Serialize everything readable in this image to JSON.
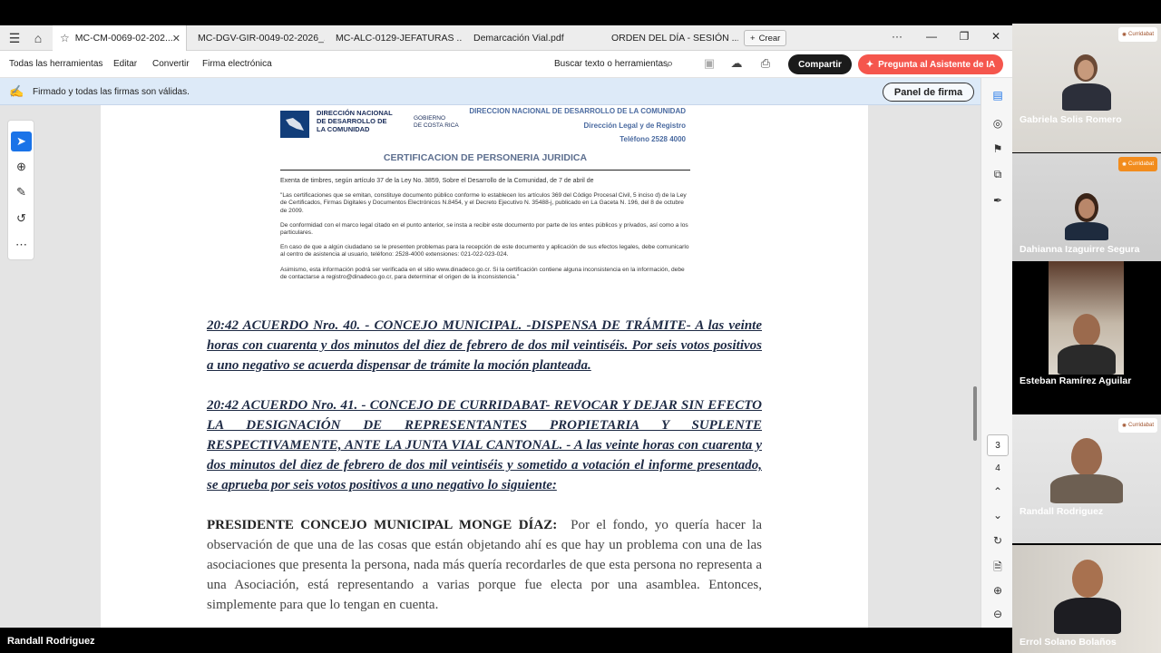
{
  "browser": {
    "tabs": [
      {
        "label": "MC-CM-0069-02-202..."
      },
      {
        "label": "MC-DGV-GIR-0049-02-2026_..."
      },
      {
        "label": "MC-ALC-0129-JEFATURAS ..."
      },
      {
        "label": "Demarcación Vial.pdf"
      },
      {
        "label": "ORDEN DEL DÍA - SESIÓN ..."
      }
    ],
    "new_tab_label": "Crear",
    "more_label": "···"
  },
  "menubar": {
    "items": [
      "Todas las herramientas",
      "Editar",
      "Convertir",
      "Firma electrónica"
    ],
    "search_label": "Buscar texto o herramientas",
    "share_label": "Compartir",
    "ai_label": "Pregunta al Asistente de IA"
  },
  "signature_bar": {
    "status": "Firmado y todas las firmas son válidas.",
    "panel_button": "Panel de firma"
  },
  "certificate": {
    "org_line1": "DIRECCIÓN NACIONAL",
    "org_line2": "DE DESARROLLO DE",
    "org_line3": "LA COMUNIDAD",
    "gov_line1": "GOBIERNO",
    "gov_line2": "DE COSTA RICA",
    "header_right1": "DIRECCION NACIONAL DE DESARROLLO DE LA COMUNIDAD",
    "header_right2": "Dirección Legal y de Registro",
    "header_right3": "Teléfono 2528 4000",
    "title": "CERTIFICACION DE PERSONERIA JURIDICA",
    "p1": "Exenta de timbres, según artículo 37 de la Ley No. 3859, Sobre el Desarrollo de la Comunidad, de 7 de abril de",
    "p2": "\"Las certificaciones que se emitan, constituye documento público conforme lo establecen los artículos 369 del Código Procesal Civil, 5 inciso d) de la Ley de Certificados, Firmas Digitales y Documentos Electrónicos N.8454, y el Decreto Ejecutivo N. 35488-j, publicado en La Gaceta N. 196, del 8 de octubre de 2009.",
    "p3": "De conformidad con el marco legal citado en el punto anterior, se insta a recibir este documento por parte de los entes públicos y privados, así como a los particulares.",
    "p4": "En caso de que a algún ciudadano se le presenten problemas para la recepción de este documento y aplicación de sus efectos legales, debe comunicarlo al centro de asistencia al usuario, teléfono: 2528-4000 extensiones: 021-022-023-024.",
    "p5": "Asimismo, esta información podrá ser verificada en el sitio www.dinadeco.go.cr. Si la certificación contiene alguna inconsistencia en la información, debe de contactarse a registro@dinadeco.go.cr, para determinar el origen de la inconsistencia.\""
  },
  "document": {
    "acuerdo40": "20:42 ACUERDO Nro. 40. - CONCEJO MUNICIPAL. -DISPENSA DE TRÁMITE- A las veinte horas con cuarenta y dos minutos del diez de febrero de dos mil veintiséis. Por seis votos positivos a uno negativo se acuerda dispensar de trámite la moción planteada.",
    "acuerdo41": "20:42 ACUERDO Nro. 41. - CONCEJO DE CURRIDABAT- REVOCAR Y DEJAR SIN EFECTO LA DESIGNACIÓN DE REPRESENTANTES PROPIETARIA Y SUPLENTE RESPECTIVAMENTE, ANTE LA JUNTA VIAL CANTONAL. - A las veinte horas con cuarenta y dos minutos del diez de febrero de dos mil veintiséis y sometido a votación el informe presentado, se aprueba por seis votos positivos a uno negativo lo siguiente:",
    "speaker": "PRESIDENTE CONCEJO MUNICIPAL MONGE DÍAZ:",
    "speech": "Por el fondo, yo quería hacer la observación de que una de las cosas que están objetando ahí es que hay un problema con una de las asociaciones que presenta la persona, nada más quería recordarles de que esta persona no representa a una Asociación, está representando a varias porque fue electa por una asamblea. Entonces, simplemente para que lo tengan en cuenta."
  },
  "page_nav": {
    "current": "3",
    "total": "4"
  },
  "presenter_name": "Randall Rodriguez",
  "participants": [
    {
      "name": "Gabriela Solis Romero",
      "brand": "Curridabat"
    },
    {
      "name": "Dahianna Izaguirre Segura",
      "brand": "Curridabat"
    },
    {
      "name": "Esteban  Ramírez Aguilar",
      "brand": ""
    },
    {
      "name": "Randall Rodriguez",
      "brand": "Curridabat"
    },
    {
      "name": "Errol Solano Bolaños",
      "brand": ""
    }
  ]
}
